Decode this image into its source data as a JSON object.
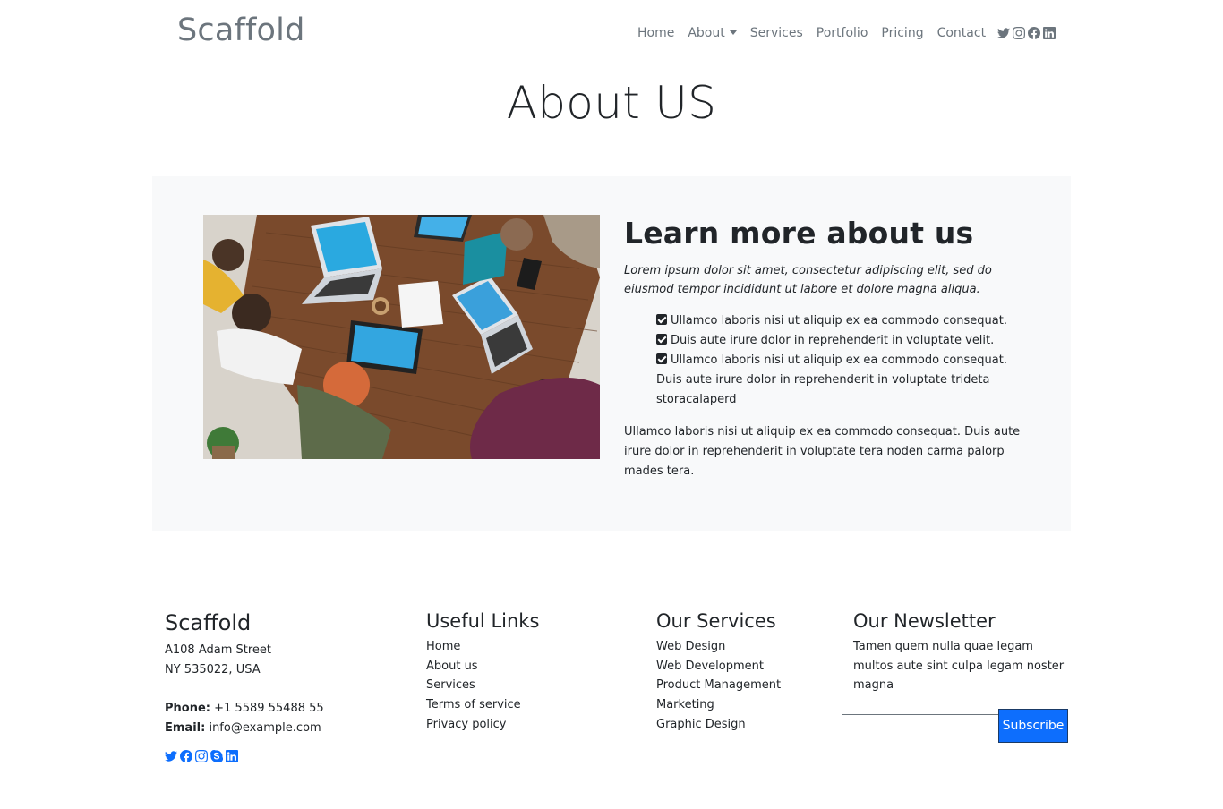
{
  "header": {
    "brand": "Scaffold",
    "nav": [
      {
        "label": "Home"
      },
      {
        "label": "About"
      },
      {
        "label": "Services"
      },
      {
        "label": "Portfolio"
      },
      {
        "label": "Pricing"
      },
      {
        "label": "Contact"
      }
    ],
    "social_icons": [
      "twitter-icon",
      "instagram-icon",
      "facebook-icon",
      "linkedin-icon"
    ]
  },
  "page": {
    "title": "About US"
  },
  "about": {
    "image_icon": "team-meeting-photo",
    "heading": "Learn more about us",
    "intro": "Lorem ipsum dolor sit amet, consectetur adipiscing elit, sed do eiusmod tempor incididunt ut labore et dolore magna aliqua.",
    "checklist": [
      "Ullamco laboris nisi ut aliquip ex ea commodo consequat.",
      "Duis aute irure dolor in reprehenderit in voluptate velit.",
      "Ullamco laboris nisi ut aliquip ex ea commodo consequat. Duis aute irure dolor in reprehenderit in voluptate trideta storacalaperd"
    ],
    "outro": "Ullamco laboris nisi ut aliquip ex ea commodo consequat. Duis aute irure dolor in reprehenderit in voluptate tera noden carma palorp mades tera."
  },
  "footer": {
    "company": {
      "name": "Scaffold",
      "address_line1": "A108 Adam Street",
      "address_line2": "NY 535022, USA",
      "phone_label": "Phone:",
      "phone": "+1 5589 55488 55",
      "email_label": "Email:",
      "email": "info@example.com",
      "social_icons": [
        "twitter-icon",
        "facebook-icon",
        "instagram-icon",
        "skype-icon",
        "linkedin-icon"
      ]
    },
    "useful_links": {
      "title": "Useful Links",
      "items": [
        "Home",
        "About us",
        "Services",
        "Terms of service",
        "Privacy policy"
      ]
    },
    "services": {
      "title": "Our Services",
      "items": [
        "Web Design",
        "Web Development",
        "Product Management",
        "Marketing",
        "Graphic Design"
      ]
    },
    "newsletter": {
      "title": "Our Newsletter",
      "text": "Tamen quem nulla quae legam multos aute sint culpa legam noster magna",
      "input_value": "",
      "button_label": "Subscribe"
    }
  },
  "colors": {
    "muted": "#6c757d",
    "section_bg": "#f8f9fa",
    "accent": "#0d6efd",
    "text": "#212529"
  }
}
